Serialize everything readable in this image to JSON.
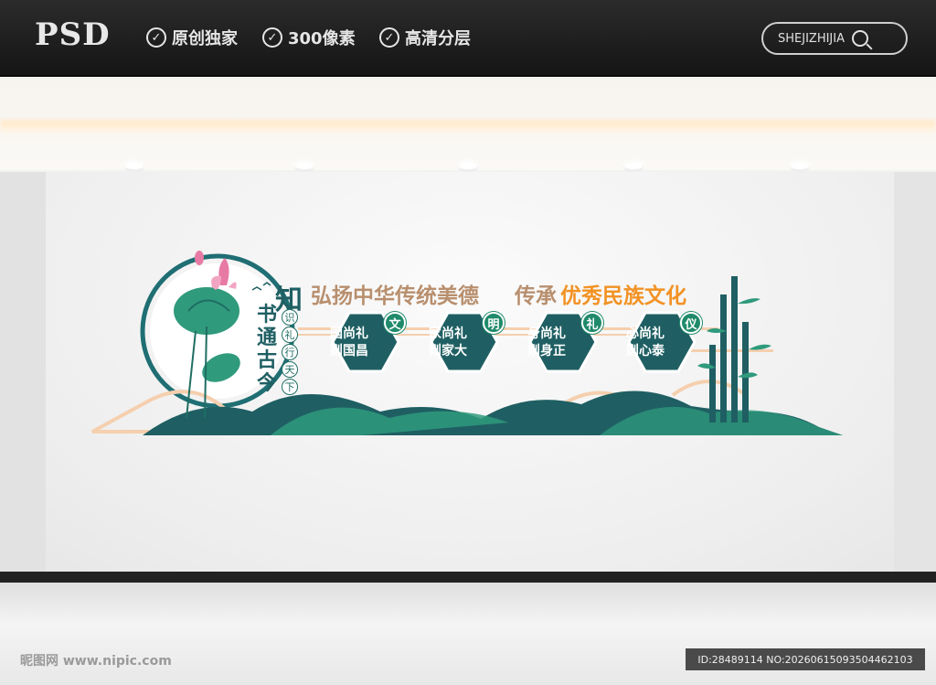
{
  "banner": {
    "logo": "PSD",
    "features": [
      "原创独家",
      "300像素",
      "高清分层"
    ],
    "search_text": "SHEJIZHIJIA"
  },
  "wall_art": {
    "slogan_part1": "弘扬中华传统美德",
    "slogan_part2_a": "传承",
    "slogan_part2_b": "优秀民族文化",
    "title_big": "知",
    "title_vertical": "书通古今",
    "title_circles": [
      "识",
      "礼",
      "行",
      "天",
      "下"
    ],
    "hexagons": [
      {
        "badge": "文",
        "line1": "国尚礼",
        "line2": "则国昌"
      },
      {
        "badge": "明",
        "line1": "家尚礼",
        "line2": "则家大"
      },
      {
        "badge": "礼",
        "line1": "身尚礼",
        "line2": "则身正"
      },
      {
        "badge": "仪",
        "line1": "心尚礼",
        "line2": "则心泰"
      }
    ],
    "colors": {
      "teal": "#1f5f63",
      "green": "#2f9a7c",
      "tan": "#b88f6e",
      "orange": "#f29224",
      "peach": "#f5cfae"
    }
  },
  "footer": {
    "left": "昵图网 www.nipic.com",
    "right": "ID:28489114 NO:20260615093504462103"
  }
}
